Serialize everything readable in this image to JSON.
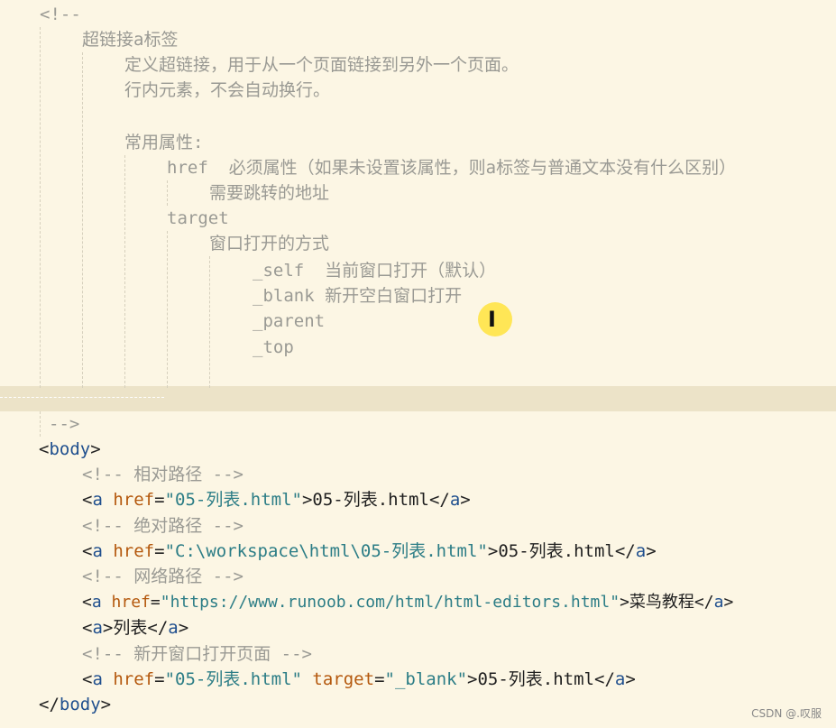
{
  "comment_block": {
    "open": "<!--",
    "heading": "超链接a标签",
    "definition": "定义超链接，用于从一个页面链接到另外一个页面。",
    "inline_note": "行内元素，不会自动换行。",
    "attrs_heading": "常用属性:",
    "href_name": "href",
    "href_desc": "必须属性（如果未设置该属性，则a标签与普通文本没有什么区别）",
    "href_detail": "需要跳转的地址",
    "target_name": "target",
    "target_desc": "窗口打开的方式",
    "self_name": "_self",
    "self_desc": "当前窗口打开（默认）",
    "blank_name": "_blank",
    "blank_desc": "新开空白窗口打开",
    "parent_name": "_parent",
    "top_name": "_top",
    "close": "-->"
  },
  "body_code": {
    "body_tag": "body",
    "a_tag": "a",
    "href_attr": "href",
    "target_attr": "target",
    "comment_relative": "<!-- 相对路径 -->",
    "comment_absolute": "<!-- 绝对路径 -->",
    "comment_network": "<!-- 网络路径 -->",
    "comment_newwindow": "<!-- 新开窗口打开页面 -->",
    "link1_href": "\"05-列表.html\"",
    "link1_text": "05-列表.html",
    "link2_href": "\"C:\\workspace\\html\\05-列表.html\"",
    "link2_text": "05-列表.html",
    "link3_href": "\"https://www.runoob.com/html/html-editors.html\"",
    "link3_text": "菜鸟教程",
    "link4_text": "列表",
    "link5_href": "\"05-列表.html\"",
    "link5_target": "\"_blank\"",
    "link5_text": "05-列表.html"
  },
  "watermark": "CSDN @.叹服",
  "icons": {
    "cursor": "text-cursor-icon"
  }
}
